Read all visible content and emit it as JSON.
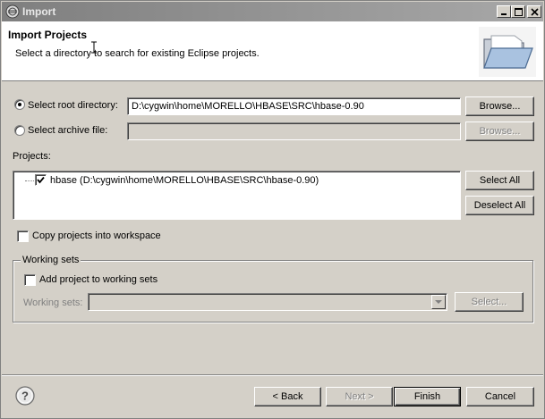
{
  "window": {
    "title": "Import",
    "icon": "eclipse-icon"
  },
  "header": {
    "title": "Import Projects",
    "description": "Select a directory to search for existing Eclipse projects.",
    "icon": "folder-open-icon"
  },
  "source": {
    "root_directory_label": "Select root directory:",
    "root_directory_value": "D:\\cygwin\\home\\MORELLO\\HBASE\\SRC\\hbase-0.90",
    "root_directory_selected": true,
    "archive_label": "Select archive file:",
    "archive_value": "",
    "browse_label": "Browse...",
    "browse_archive_label": "Browse..."
  },
  "projects": {
    "label": "Projects:",
    "items": [
      {
        "label": "hbase (D:\\cygwin\\home\\MORELLO\\HBASE\\SRC\\hbase-0.90)",
        "checked": true
      }
    ],
    "select_all_label": "Select All",
    "deselect_all_label": "Deselect All"
  },
  "copy_projects_label": "Copy projects into workspace",
  "working_sets": {
    "group_label": "Working sets",
    "add_label": "Add project to working sets",
    "sets_label": "Working sets:",
    "sets_value": "",
    "select_label": "Select..."
  },
  "footer": {
    "help_icon": "help-icon",
    "back_label": "< Back",
    "next_label": "Next >",
    "finish_label": "Finish",
    "cancel_label": "Cancel"
  }
}
